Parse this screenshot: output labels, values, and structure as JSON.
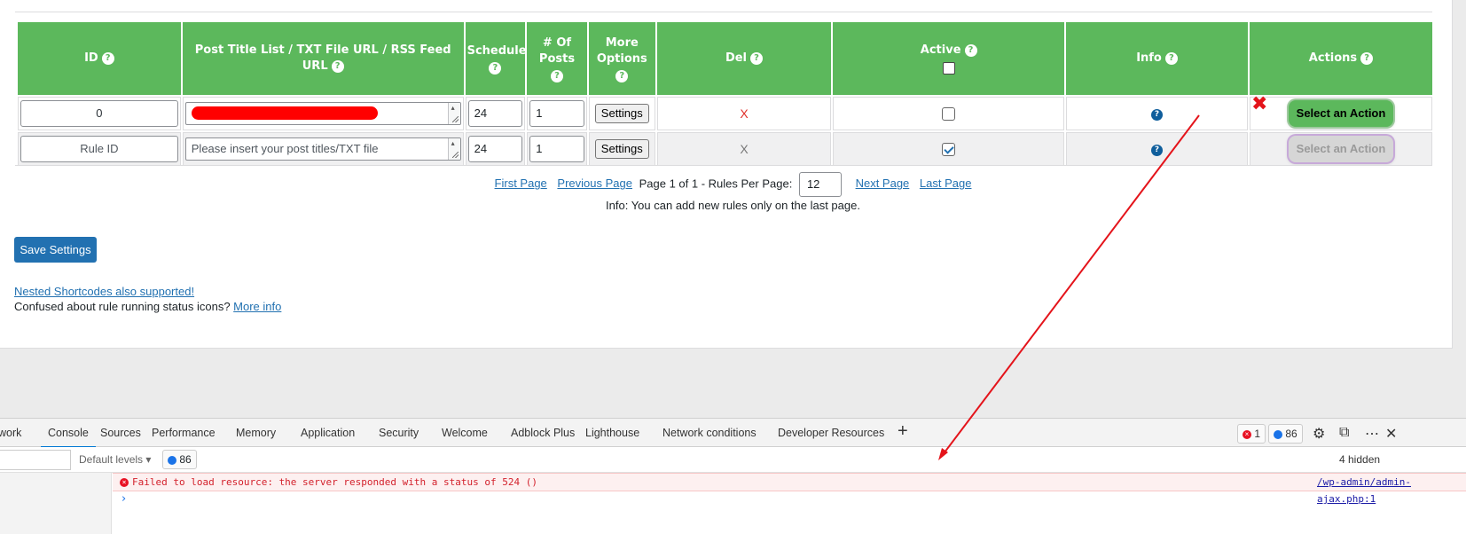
{
  "table": {
    "headers": {
      "id": "ID",
      "post_title": "Post Title List / TXT File URL / RSS Feed URL",
      "schedule": "Schedule",
      "num_posts": "# Of Posts",
      "more_options": "More Options",
      "del": "Del",
      "active": "Active",
      "info": "Info",
      "actions": "Actions"
    },
    "help_glyph": "?",
    "rows": [
      {
        "id": "0",
        "title_value": "",
        "schedule": "24",
        "num_posts": "1",
        "settings": "Settings",
        "del": "X",
        "active": false,
        "info_glyph": "?",
        "action": "Select an Action",
        "action_enabled": true
      },
      {
        "id_placeholder": "Rule ID",
        "title_placeholder": "Please insert your post titles/TXT file",
        "schedule": "24",
        "num_posts": "1",
        "settings": "Settings",
        "del": "X",
        "active": true,
        "info_glyph": "?",
        "action": "Select an Action",
        "action_enabled": false
      }
    ]
  },
  "pagination": {
    "first": "First Page",
    "previous": "Previous Page",
    "status": "Page 1 of 1 - Rules Per Page:",
    "per_page": "12",
    "next": "Next Page",
    "last": "Last Page",
    "info": "Info: You can add new rules only on the last page."
  },
  "save_button": "Save Settings",
  "links": {
    "nested": "Nested Shortcodes also supported!",
    "confused_text": "Confused about rule running status icons?",
    "more_info": "More info"
  },
  "annotation": {
    "mark": "✖",
    "color": "#e4141b"
  },
  "devtools": {
    "tabs": [
      "work",
      "Console",
      "Sources",
      "Performance",
      "Memory",
      "Application",
      "Security",
      "Welcome",
      "Adblock Plus",
      "Lighthouse",
      "Network conditions",
      "Developer Resources"
    ],
    "active_tab": "Console",
    "error_count": "1",
    "message_count": "86",
    "filter": {
      "levels": "Default levels",
      "message_count": "86",
      "hidden": "4 hidden"
    },
    "console": {
      "error_message": "Failed to load resource: the server responded with a status of 524 ()",
      "error_source": "/wp-admin/admin-ajax.php:1"
    },
    "icons": [
      "plus-icon",
      "gear-icon",
      "dock-icon",
      "more-icon",
      "close-icon"
    ]
  },
  "colors": {
    "header_green": "#5cb85c",
    "link_blue": "#2271b1",
    "error_red": "#d3212c",
    "redaction": "#ff0000"
  }
}
